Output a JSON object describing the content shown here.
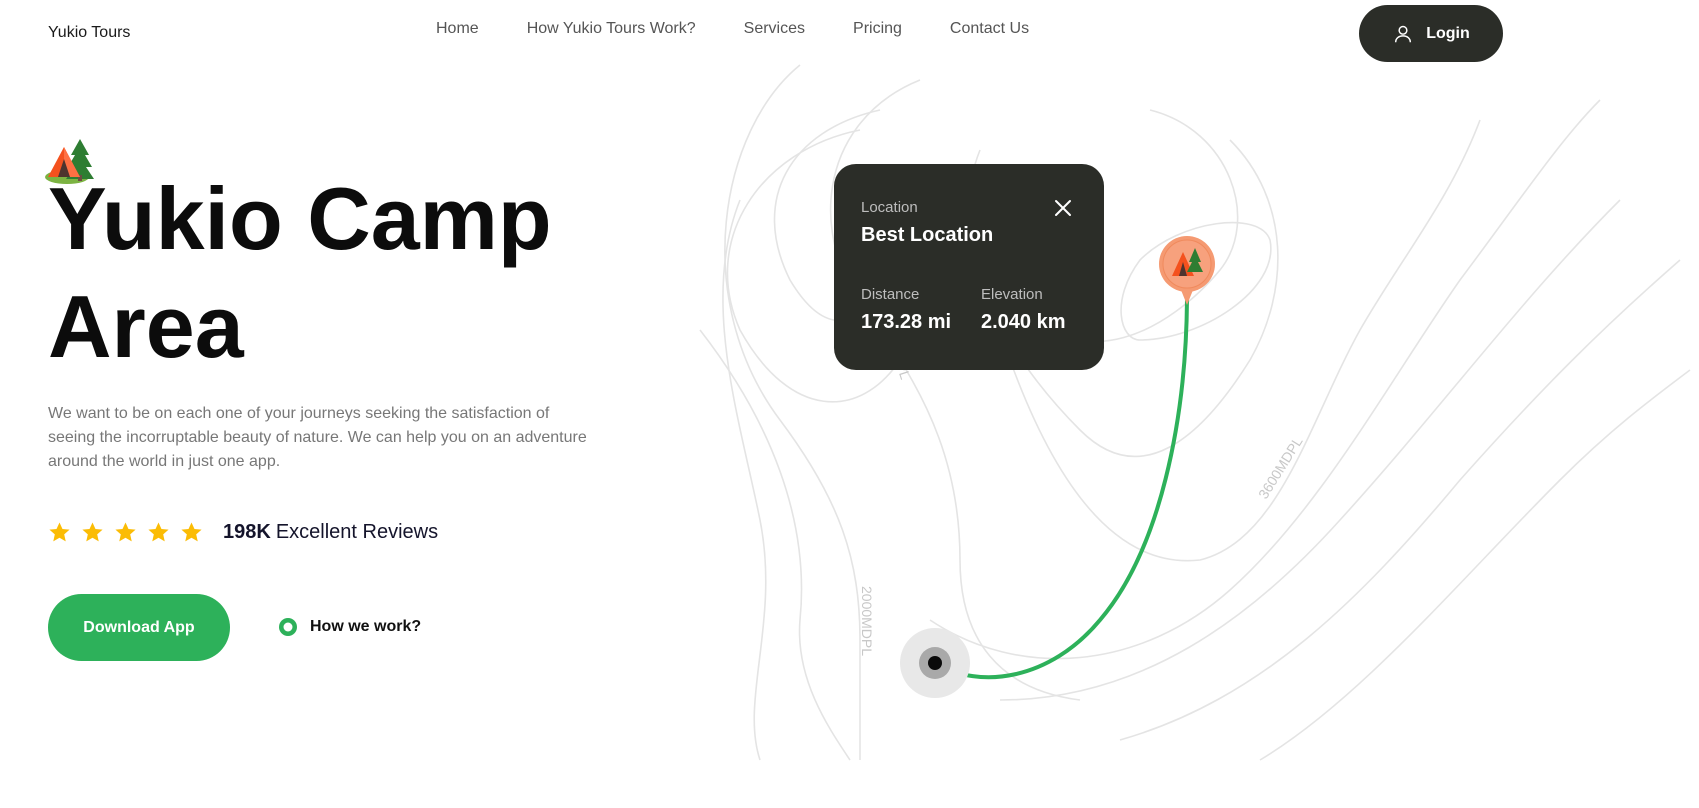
{
  "header": {
    "brand": "Yukio Tours",
    "nav": [
      "Home",
      "How Yukio Tours Work?",
      "Services",
      "Pricing",
      "Contact Us"
    ],
    "login_label": "Login"
  },
  "hero": {
    "title_line1": "Yukio Camp",
    "title_line2": "Area",
    "description": "We want to be on each one of your journeys seeking the satisfaction of seeing the incorruptable beauty of nature. We can help you on an adventure around the world in just one app.",
    "rating": {
      "stars": 5,
      "count": "198K",
      "label": "Excellent Reviews"
    },
    "download_label": "Download App",
    "how_label": "How we work?"
  },
  "map": {
    "contour_labels": [
      "3600MDPL",
      "2000MDPL",
      "PL"
    ],
    "route_color": "#2db15a",
    "marker_color": "#f59a72",
    "card": {
      "location_label": "Location",
      "location_value": "Best Location",
      "distance_label": "Distance",
      "distance_value": "173.28 mi",
      "elevation_label": "Elevation",
      "elevation_value": "2.040 km"
    }
  },
  "colors": {
    "accent": "#2db15a",
    "dark": "#2b2d28",
    "star": "#fbbc05"
  }
}
